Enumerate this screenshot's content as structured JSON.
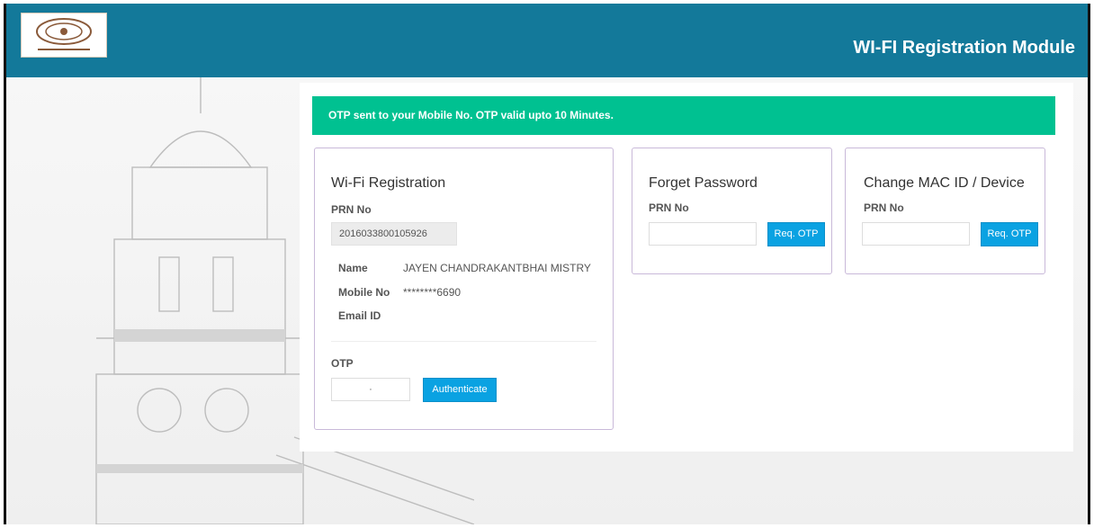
{
  "header": {
    "title": "WI-FI Registration Module"
  },
  "alert": {
    "message": "OTP sent to your Mobile No. OTP valid upto 10 Minutes."
  },
  "wifi_registration": {
    "title": "Wi-Fi Registration",
    "prn_label": "PRN No",
    "prn_value": "2016033800105926",
    "name_label": "Name",
    "name_value": "JAYEN CHANDRAKANTBHAI MISTRY",
    "mobile_label": "Mobile No",
    "mobile_value": "********6690",
    "email_label": "Email ID",
    "email_value": "",
    "otp_label": "OTP",
    "otp_value": "·",
    "authenticate_label": "Authenticate"
  },
  "forget_password": {
    "title": "Forget Password",
    "prn_label": "PRN No",
    "prn_value": "",
    "req_otp_label": "Req. OTP"
  },
  "change_mac": {
    "title": "Change MAC ID / Device",
    "prn_label": "PRN No",
    "prn_value": "",
    "req_otp_label": "Req. OTP"
  },
  "colors": {
    "header": "#13799a",
    "alert": "#00c191",
    "button": "#0aa2e2"
  },
  "icons": {
    "logo": "university-seal-logo"
  }
}
